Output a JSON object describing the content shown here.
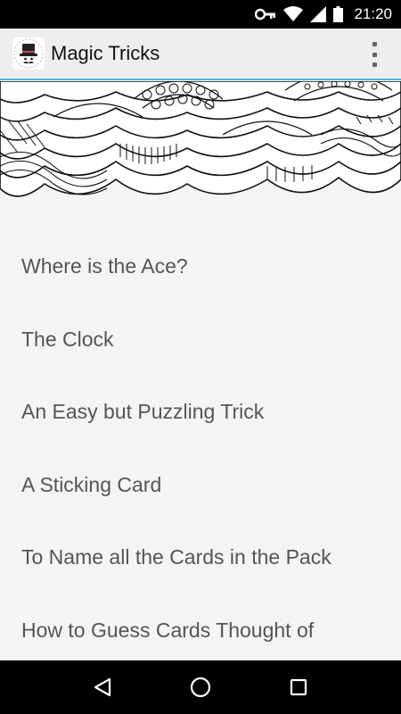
{
  "status_bar": {
    "time": "21:20",
    "icons": [
      "vpn-key-icon",
      "wifi-icon",
      "signal-icon",
      "battery-icon"
    ]
  },
  "app_bar": {
    "title": "Magic Tricks",
    "icon": "magician-hat-icon",
    "overflow_icon": "more-vert-icon",
    "accent_color": "#4fb8d8"
  },
  "header": {
    "image": "decorative-doodle-pattern"
  },
  "tricks": [
    {
      "label": "Where is the Ace?"
    },
    {
      "label": "The Clock"
    },
    {
      "label": "An Easy but Puzzling Trick"
    },
    {
      "label": "A Sticking Card"
    },
    {
      "label": "To Name all the Cards in the Pack"
    },
    {
      "label": "How to Guess Cards Thought of"
    }
  ],
  "nav_bar": {
    "back_icon": "back-triangle-icon",
    "home_icon": "home-circle-icon",
    "recents_icon": "recents-square-icon"
  }
}
